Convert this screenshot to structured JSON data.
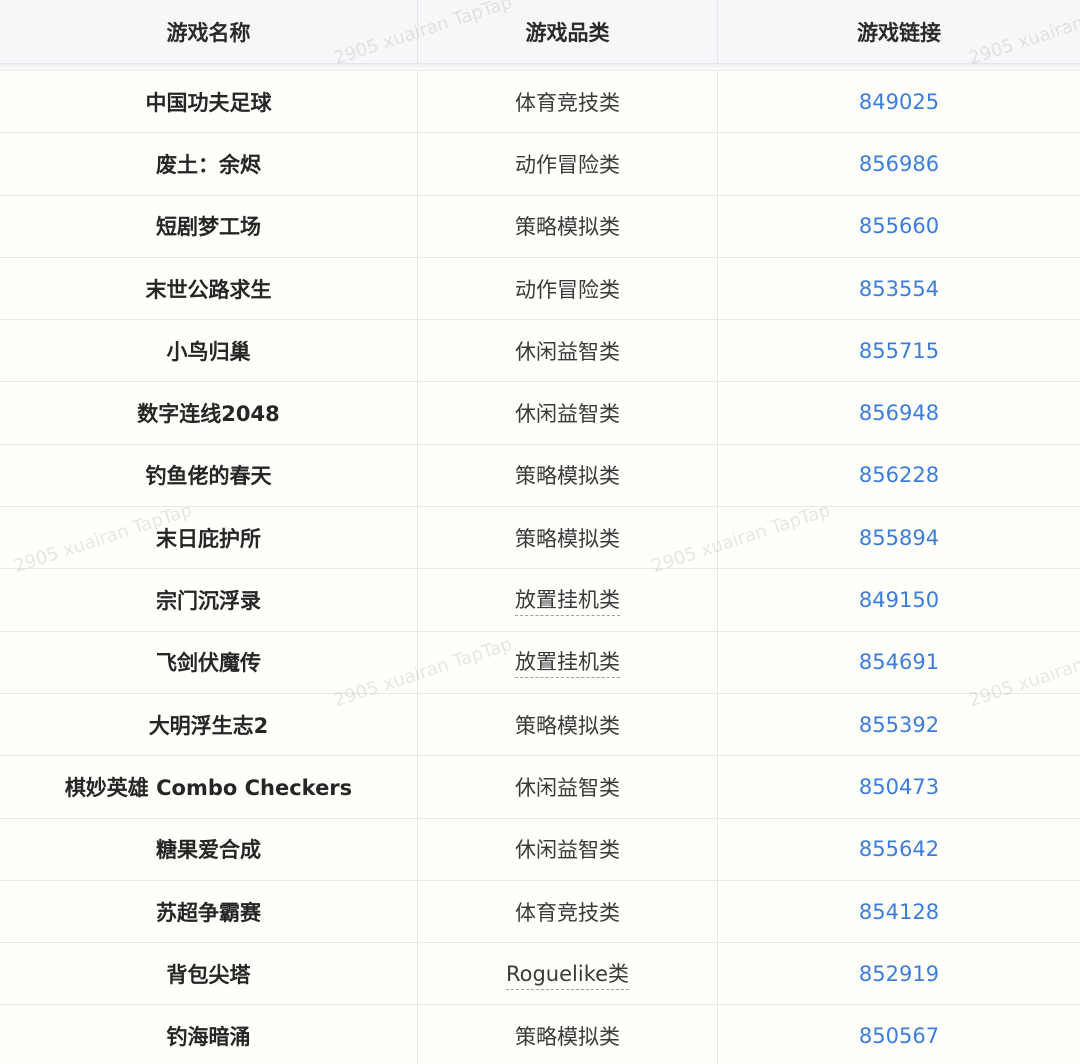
{
  "table": {
    "headers": [
      "游戏名称",
      "游戏品类",
      "游戏链接"
    ],
    "rows": [
      {
        "name": "中国功夫足球",
        "category": "体育竞技类",
        "link": "849025"
      },
      {
        "name": "废土：余烬",
        "category": "动作冒险类",
        "link": "856986"
      },
      {
        "name": "短剧梦工场",
        "category": "策略模拟类",
        "link": "855660"
      },
      {
        "name": "末世公路求生",
        "category": "动作冒险类",
        "link": "853554"
      },
      {
        "name": "小鸟归巢",
        "category": "休闲益智类",
        "link": "855715"
      },
      {
        "name": "数字连线2048",
        "category": "休闲益智类",
        "link": "856948"
      },
      {
        "name": "钓鱼佬的春天",
        "category": "策略模拟类",
        "link": "856228"
      },
      {
        "name": "末日庇护所",
        "category": "策略模拟类",
        "link": "855894"
      },
      {
        "name": "宗门沉浮录",
        "category": "放置挂机类",
        "link": "849150"
      },
      {
        "name": "飞剑伏魔传",
        "category": "放置挂机类",
        "link": "854691"
      },
      {
        "name": "大明浮生志2",
        "category": "策略模拟类",
        "link": "855392"
      },
      {
        "name": "棋妙英雄 Combo Checkers",
        "category": "休闲益智类",
        "link": "850473"
      },
      {
        "name": "糖果爱合成",
        "category": "休闲益智类",
        "link": "855642"
      },
      {
        "name": "苏超争霸赛",
        "category": "体育竞技类",
        "link": "854128"
      },
      {
        "name": "背包尖塔",
        "category": "Roguelike类",
        "link": "852919"
      },
      {
        "name": "钓海暗涌",
        "category": "策略模拟类",
        "link": "850567"
      }
    ]
  },
  "watermark": {
    "text": "2905 xuairan TapTap"
  },
  "colors": {
    "link": "#3b7ddd",
    "header_bg": "#f6f7f9",
    "row_bg": "#fffefb"
  }
}
